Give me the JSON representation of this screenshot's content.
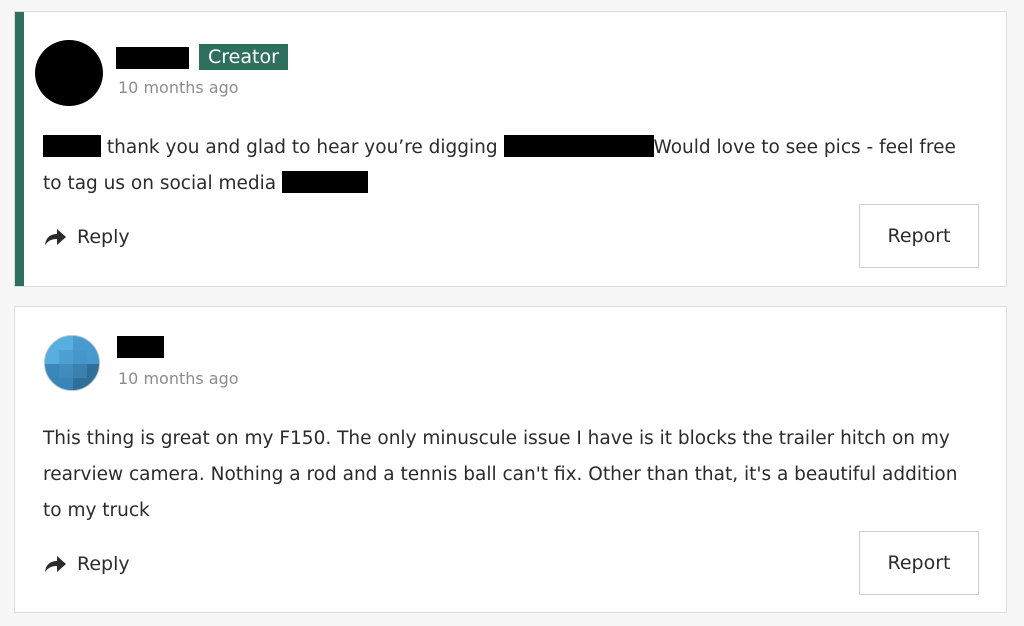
{
  "colors": {
    "accent": "#2e6f5e",
    "badge_bg": "#2e6f5e"
  },
  "comments": [
    {
      "author": "",
      "badge": "Creator",
      "timestamp": "10 months ago",
      "text_part1": "thank you and glad to hear you’re digging",
      "text_part2": "Would love to see pics - feel free to tag us on social media",
      "reply_label": "Reply",
      "report_label": "Report",
      "avatar_icon": "avatar-redacted"
    },
    {
      "author": "",
      "timestamp": "10 months ago",
      "text": "This thing is great on my F150. The only minuscule issue I have is it blocks the trailer hitch on my rearview camera. Nothing a rod and a tennis ball can't fix. Other than that, it's a beautiful addition to my truck",
      "reply_label": "Reply",
      "report_label": "Report",
      "avatar_icon": "avatar-globe"
    }
  ],
  "icons": {
    "reply": "reply-arrow-icon"
  }
}
